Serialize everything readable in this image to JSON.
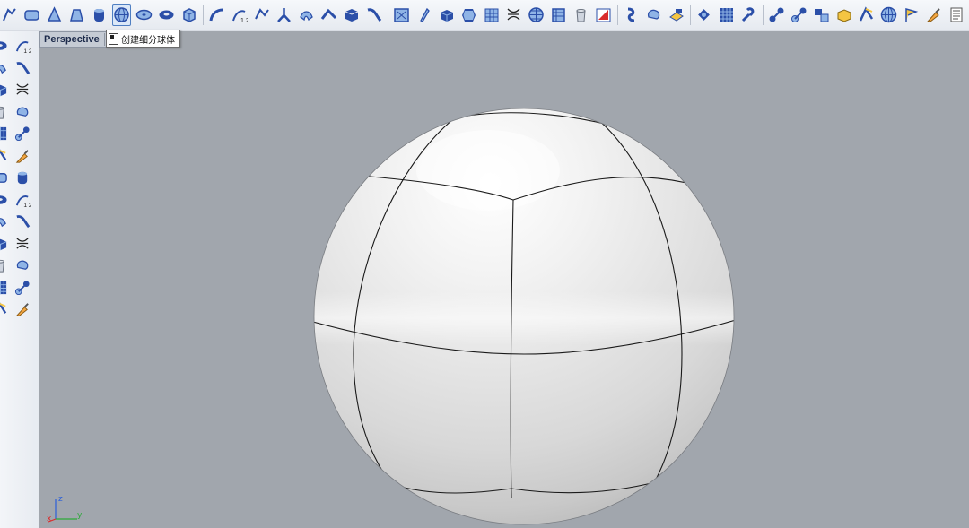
{
  "viewport": {
    "title": "Perspective",
    "dropdown_glyph": "▼"
  },
  "tooltip": {
    "text": "创建细分球体"
  },
  "axes": {
    "x_label": "x",
    "y_label": "y",
    "z_label": "z",
    "colors": {
      "x": "#d92b2b",
      "y": "#2caa3a",
      "z": "#2b5fd9"
    }
  },
  "colors": {
    "viewport_bg": "#a1a6ad",
    "icon_blue": "#2b4fa8",
    "icon_light": "#8fb4e6",
    "active_border": "#4f7fc2"
  },
  "top_toolbar": {
    "icons": [
      "subd-edit-icon",
      "subd-plane-icon",
      "subd-cone-icon",
      "subd-truncated-cone-icon",
      "subd-cylinder-icon",
      "subd-sphere-icon",
      "subd-ellipsoid-icon",
      "subd-torus-icon",
      "subd-box-icon",
      "subd-loft-icon",
      "subd-sweep-icon",
      "subd-sweep2-icon",
      "subd-bridge-icon",
      "subd-tube-icon",
      "subd-fillet-icon",
      "subd-crease-icon",
      "subd-insert-edge-icon",
      "subd-slide-icon",
      "subd-bevel-icon",
      "subd-extrude-icon",
      "subd-append-icon",
      "subd-box-solid-icon",
      "subd-polygon-icon",
      "subd-pattern-icon",
      "subd-stitch-icon",
      "subd-grid-icon",
      "subd-subdivide-icon",
      "subd-cylinder-cap-icon",
      "subd-delete-icon",
      "subd-symmetry-icon",
      "subd-unwrap-icon",
      "subd-flip-icon",
      "subd-patch-icon",
      "mesh-grid-icon",
      "repair-tools-icon",
      "mesh-join-icon",
      "mesh-split-icon",
      "mesh-to-subd-icon",
      "subd-match-icon",
      "subd-offset-icon",
      "subd-globe-icon",
      "subd-flag-icon",
      "subd-brush-icon",
      "subd-options-icon"
    ],
    "active_index": 5
  },
  "left_toolbar": {
    "icons": [
      "transform-icon",
      "eraser-icon",
      "stack-icon",
      "join-edge-icon",
      "layers-icon",
      "extrude-face-icon",
      "pin-icon",
      "cylinder-face-icon",
      "disk-icon",
      "arc-edge-icon",
      "curve-icon",
      "sweep-rail-icon",
      "bend-icon",
      "loft-face-icon",
      "frame-icon",
      "taper-icon",
      "hourglass-icon",
      "skew-icon",
      "scatter-icon",
      "grid-cells-icon",
      "grid-points-icon",
      "dot-matrix-icon",
      "align-icon",
      "gizmo-icon",
      "lock-icon",
      "cylinder-lock-icon"
    ]
  }
}
